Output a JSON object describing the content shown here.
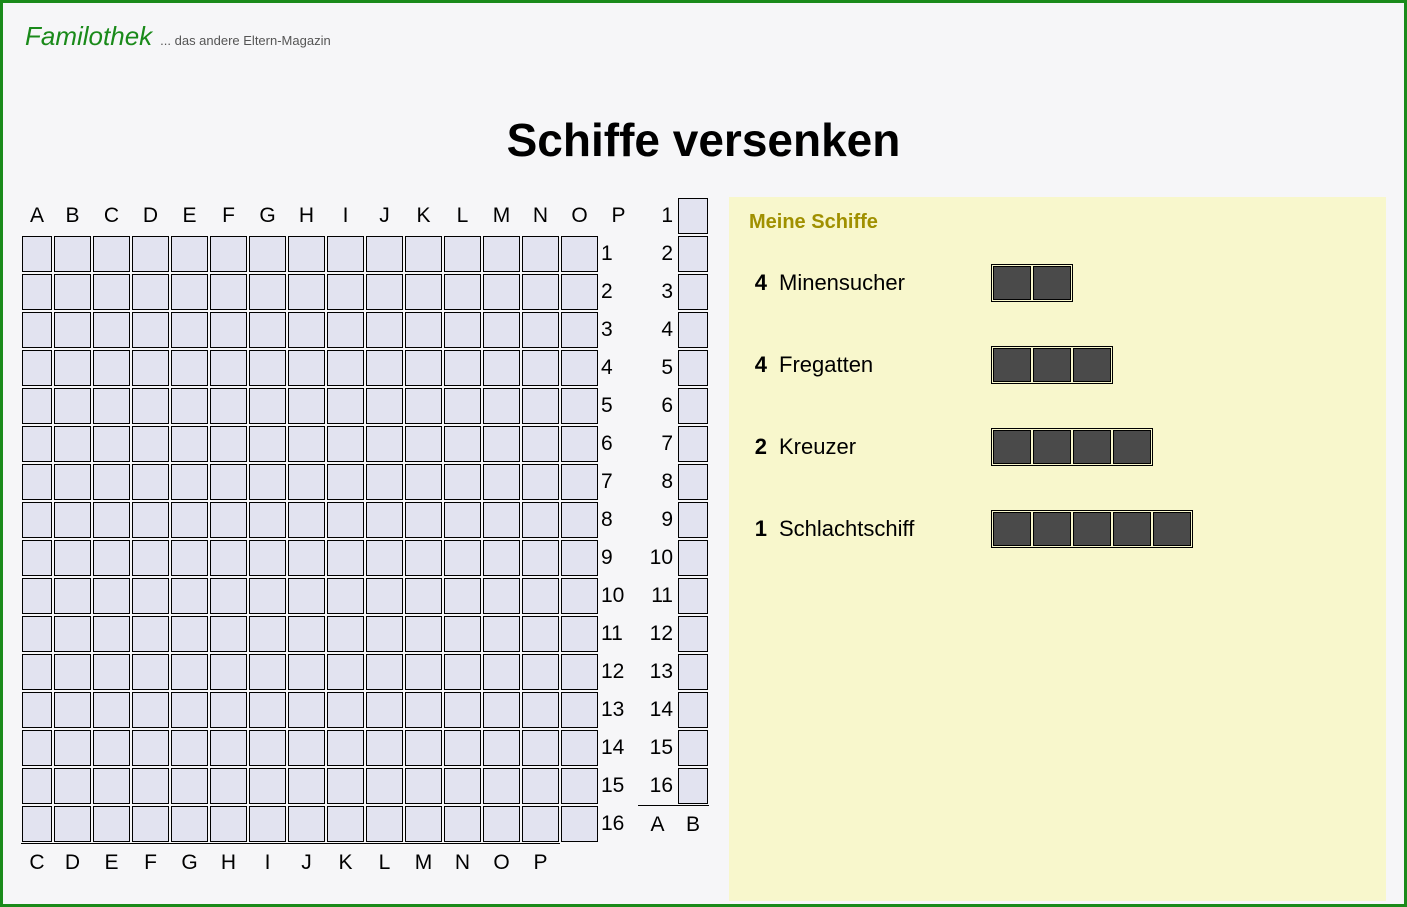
{
  "logo": {
    "main": "Familothek",
    "sub": "... das andere Eltern-Magazin"
  },
  "title": "Schiffe versenken",
  "grid": {
    "columns": [
      "A",
      "B",
      "C",
      "D",
      "E",
      "F",
      "G",
      "H",
      "I",
      "J",
      "K",
      "L",
      "M",
      "N",
      "O",
      "P"
    ],
    "rows": [
      "1",
      "2",
      "3",
      "4",
      "5",
      "6",
      "7",
      "8",
      "9",
      "10",
      "11",
      "12",
      "13",
      "14",
      "15",
      "16"
    ]
  },
  "ships_panel": {
    "title": "Meine Schiffe",
    "ships": [
      {
        "count": "4",
        "name": "Minensucher",
        "size": 2
      },
      {
        "count": "4",
        "name": "Fregatten",
        "size": 3
      },
      {
        "count": "2",
        "name": "Kreuzer",
        "size": 4
      },
      {
        "count": "1",
        "name": "Schlachtschiff",
        "size": 5
      }
    ]
  },
  "colors": {
    "border": "#1a8a1a",
    "grid_cell": "#e2e3f0",
    "panel_bg": "#f8f7cc",
    "ship_seg": "#4a4a4a",
    "panel_title": "#a09000"
  }
}
